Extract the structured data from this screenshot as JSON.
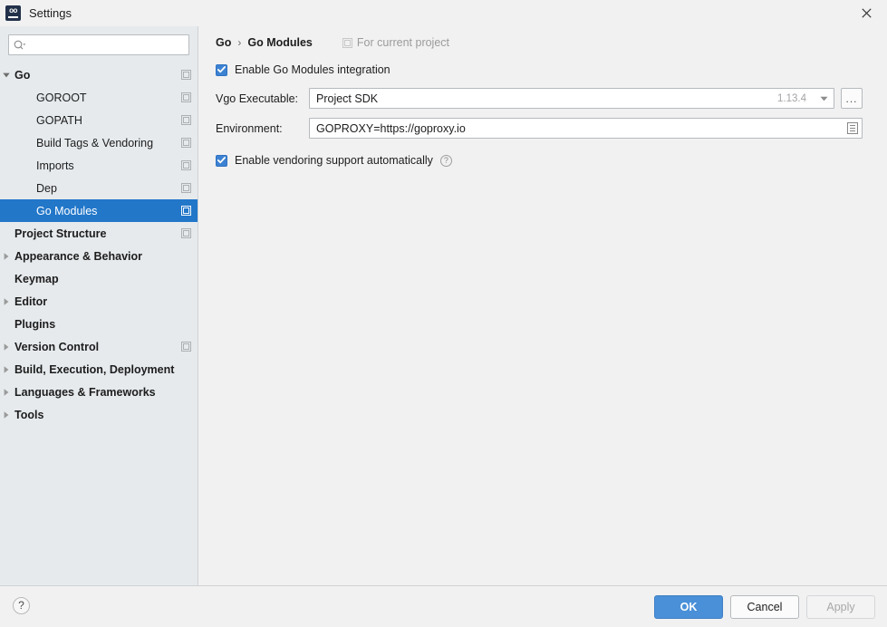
{
  "window": {
    "title": "Settings",
    "logo_icon": "go-logo-icon",
    "close_icon": "close-icon"
  },
  "sidebar": {
    "search": {
      "placeholder": "",
      "value": "",
      "icon": "search-icon"
    },
    "items": [
      {
        "label": "Go",
        "level": 0,
        "bold": true,
        "twisty": "expanded",
        "scope_icon": true,
        "selected": false
      },
      {
        "label": "GOROOT",
        "level": 1,
        "bold": false,
        "twisty": "none",
        "scope_icon": true,
        "selected": false
      },
      {
        "label": "GOPATH",
        "level": 1,
        "bold": false,
        "twisty": "none",
        "scope_icon": true,
        "selected": false
      },
      {
        "label": "Build Tags & Vendoring",
        "level": 1,
        "bold": false,
        "twisty": "none",
        "scope_icon": true,
        "selected": false
      },
      {
        "label": "Imports",
        "level": 1,
        "bold": false,
        "twisty": "none",
        "scope_icon": true,
        "selected": false
      },
      {
        "label": "Dep",
        "level": 1,
        "bold": false,
        "twisty": "none",
        "scope_icon": true,
        "selected": false
      },
      {
        "label": "Go Modules",
        "level": 1,
        "bold": false,
        "twisty": "none",
        "scope_icon": true,
        "selected": true
      },
      {
        "label": "Project Structure",
        "level": 0,
        "bold": true,
        "twisty": "none",
        "scope_icon": true,
        "selected": false
      },
      {
        "label": "Appearance & Behavior",
        "level": 0,
        "bold": true,
        "twisty": "collapsed",
        "scope_icon": false,
        "selected": false
      },
      {
        "label": "Keymap",
        "level": 0,
        "bold": true,
        "twisty": "none",
        "scope_icon": false,
        "selected": false
      },
      {
        "label": "Editor",
        "level": 0,
        "bold": true,
        "twisty": "collapsed",
        "scope_icon": false,
        "selected": false
      },
      {
        "label": "Plugins",
        "level": 0,
        "bold": true,
        "twisty": "none",
        "scope_icon": false,
        "selected": false
      },
      {
        "label": "Version Control",
        "level": 0,
        "bold": true,
        "twisty": "collapsed",
        "scope_icon": true,
        "selected": false
      },
      {
        "label": "Build, Execution, Deployment",
        "level": 0,
        "bold": true,
        "twisty": "collapsed",
        "scope_icon": false,
        "selected": false
      },
      {
        "label": "Languages & Frameworks",
        "level": 0,
        "bold": true,
        "twisty": "collapsed",
        "scope_icon": false,
        "selected": false
      },
      {
        "label": "Tools",
        "level": 0,
        "bold": true,
        "twisty": "collapsed",
        "scope_icon": false,
        "selected": false
      }
    ]
  },
  "main": {
    "breadcrumb": {
      "root": "Go",
      "separator": "›",
      "current": "Go Modules"
    },
    "scope_note": {
      "text": "For current project",
      "icon": "project-scope-icon"
    },
    "enable_modules": {
      "label": "Enable Go Modules integration",
      "checked": true
    },
    "vgo_executable": {
      "label": "Vgo Executable:",
      "value": "Project SDK",
      "version": "1.13.4",
      "dropdown_icon": "chevron-down-icon",
      "browse_label": "...",
      "browse_icon": "ellipsis-icon"
    },
    "environment": {
      "label": "Environment:",
      "value": "GOPROXY=https://goproxy.io",
      "expand_icon": "edit-list-icon"
    },
    "enable_vendoring": {
      "label": "Enable vendoring support automatically",
      "checked": true,
      "help_icon": "question-mark-icon",
      "help_glyph": "?"
    }
  },
  "footer": {
    "help_icon": "help-question-icon",
    "help_glyph": "?",
    "buttons": [
      {
        "label": "OK",
        "style": "primary",
        "enabled": true
      },
      {
        "label": "Cancel",
        "style": "normal",
        "enabled": true
      },
      {
        "label": "Apply",
        "style": "disabled",
        "enabled": false
      }
    ]
  },
  "colors": {
    "accent": "#2277c9",
    "primary_button": "#4a90d9",
    "checkbox": "#3d82d2",
    "sidebar_bg": "#e6eaed",
    "panel_bg": "#f1f1f2"
  }
}
